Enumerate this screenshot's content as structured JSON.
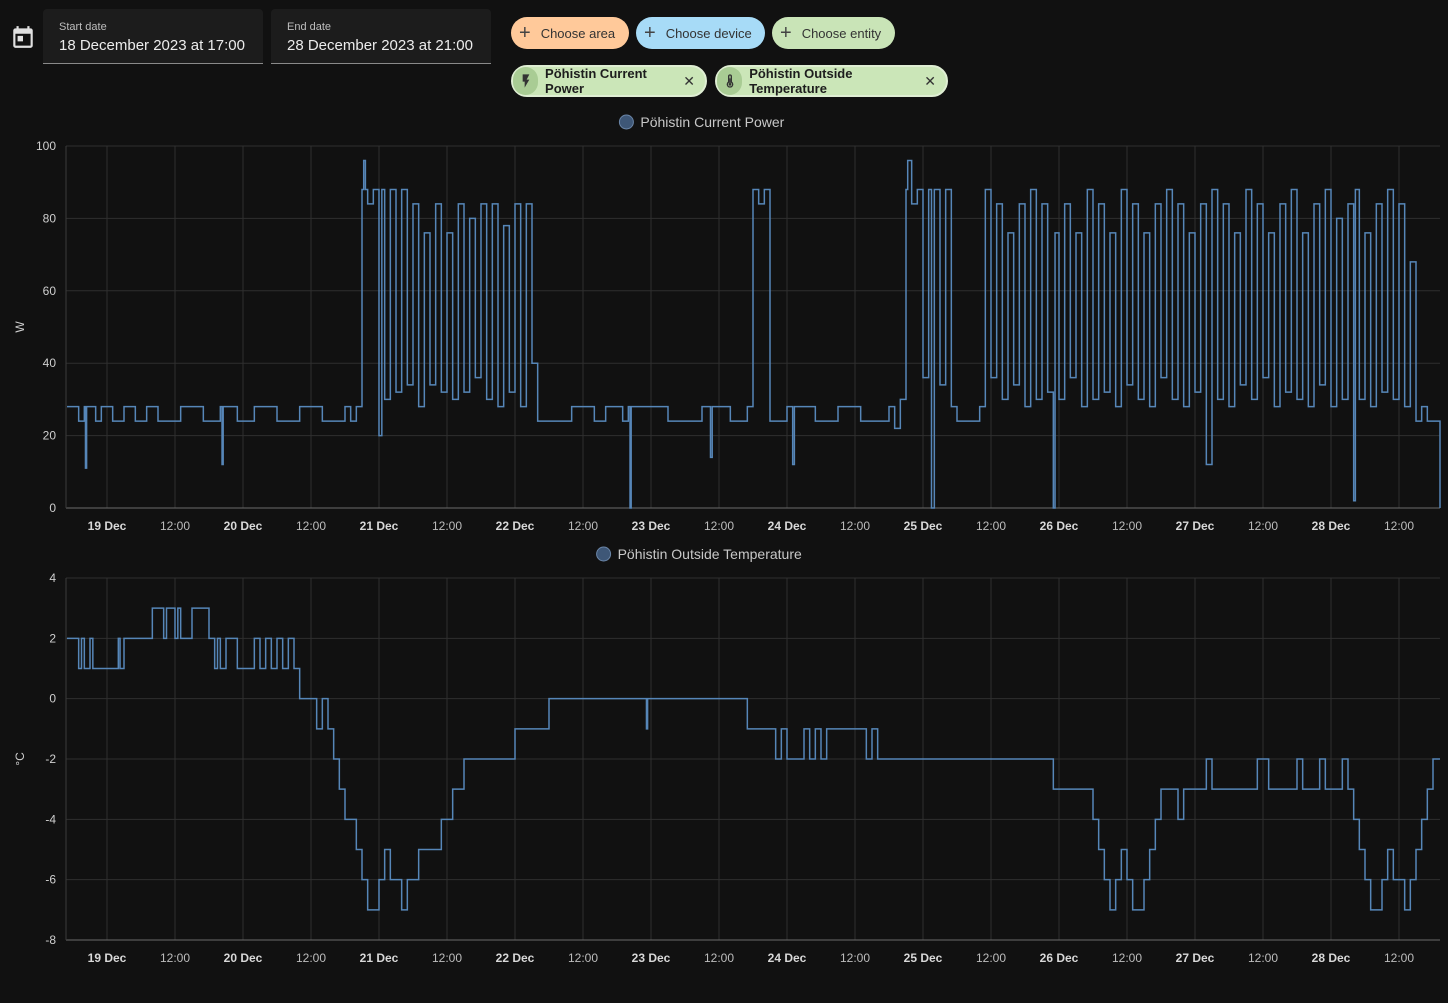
{
  "filters": {
    "start_label": "Start date",
    "start_value": "18 December 2023 at 17:00",
    "end_label": "End date",
    "end_value": "28 December 2023 at 21:00",
    "choose_area": "Choose area",
    "choose_device": "Choose device",
    "choose_entity": "Choose entity",
    "entities": [
      {
        "name": "Pöhistin Current Power",
        "icon": "flash-icon"
      },
      {
        "name": "Pöhistin Outside Temperature",
        "icon": "thermometer-icon"
      }
    ]
  },
  "colors": {
    "series": "#5686b8",
    "legend_dot": "#3e5777",
    "background": "#111111",
    "grid": "#2f2f2f"
  },
  "chart_data": [
    {
      "type": "line",
      "step": true,
      "series": [
        {
          "name": "Pöhistin Current Power"
        }
      ],
      "ylabel": "W",
      "ylim": [
        0,
        100
      ],
      "yticks": [
        "100",
        "80",
        "60",
        "40",
        "20",
        "0"
      ],
      "xticks": [
        "19 Dec",
        "12:00",
        "20 Dec",
        "12:00",
        "21 Dec",
        "12:00",
        "22 Dec",
        "12:00",
        "23 Dec",
        "12:00",
        "24 Dec",
        "12:00",
        "25 Dec",
        "12:00",
        "26 Dec",
        "12:00",
        "27 Dec",
        "12:00",
        "28 Dec",
        "12:00"
      ],
      "x_unit": "hours from 18 Dec 17:00",
      "points": [
        [
          0,
          28
        ],
        [
          2,
          24
        ],
        [
          3,
          28
        ],
        [
          3.2,
          11
        ],
        [
          3.4,
          28
        ],
        [
          5,
          24
        ],
        [
          6,
          28
        ],
        [
          8,
          24
        ],
        [
          10,
          28
        ],
        [
          12,
          24
        ],
        [
          14,
          28
        ],
        [
          16,
          24
        ],
        [
          20,
          28
        ],
        [
          24,
          24
        ],
        [
          27,
          28
        ],
        [
          27.3,
          12
        ],
        [
          27.5,
          28
        ],
        [
          30,
          24
        ],
        [
          33,
          28
        ],
        [
          37,
          24
        ],
        [
          41,
          28
        ],
        [
          45,
          24
        ],
        [
          49,
          28
        ],
        [
          50,
          24
        ],
        [
          51,
          28
        ],
        [
          52,
          88
        ],
        [
          52.3,
          96
        ],
        [
          52.6,
          88
        ],
        [
          53,
          84
        ],
        [
          54,
          88
        ],
        [
          55,
          20
        ],
        [
          55.5,
          88
        ],
        [
          56,
          30
        ],
        [
          57,
          88
        ],
        [
          58,
          32
        ],
        [
          59,
          88
        ],
        [
          60,
          34
        ],
        [
          61,
          84
        ],
        [
          62,
          28
        ],
        [
          63,
          76
        ],
        [
          64,
          34
        ],
        [
          65,
          84
        ],
        [
          66,
          32
        ],
        [
          67,
          76
        ],
        [
          68,
          30
        ],
        [
          69,
          84
        ],
        [
          70,
          32
        ],
        [
          71,
          80
        ],
        [
          72,
          36
        ],
        [
          73,
          84
        ],
        [
          74,
          30
        ],
        [
          75,
          84
        ],
        [
          76,
          28
        ],
        [
          77,
          78
        ],
        [
          78,
          32
        ],
        [
          79,
          84
        ],
        [
          80,
          28
        ],
        [
          81,
          84
        ],
        [
          82,
          40
        ],
        [
          83,
          24
        ],
        [
          89,
          28
        ],
        [
          93,
          24
        ],
        [
          95,
          28
        ],
        [
          98,
          24
        ],
        [
          99,
          28
        ],
        [
          99.3,
          0
        ],
        [
          99.5,
          28
        ],
        [
          106,
          24
        ],
        [
          112,
          28
        ],
        [
          113.5,
          14
        ],
        [
          113.8,
          28
        ],
        [
          117,
          24
        ],
        [
          120,
          28
        ],
        [
          121,
          88
        ],
        [
          122,
          84
        ],
        [
          123,
          88
        ],
        [
          124,
          24
        ],
        [
          127,
          28
        ],
        [
          128,
          12
        ],
        [
          128.3,
          28
        ],
        [
          132,
          24
        ],
        [
          136,
          28
        ],
        [
          140,
          24
        ],
        [
          145,
          28
        ],
        [
          146,
          22
        ],
        [
          147,
          30
        ],
        [
          148,
          88
        ],
        [
          148.3,
          96
        ],
        [
          149,
          84
        ],
        [
          150,
          88
        ],
        [
          151,
          36
        ],
        [
          152,
          88
        ],
        [
          152.5,
          0
        ],
        [
          153,
          88
        ],
        [
          154,
          34
        ],
        [
          155,
          88
        ],
        [
          156,
          28
        ],
        [
          157,
          24
        ],
        [
          161,
          28
        ],
        [
          162,
          88
        ],
        [
          163,
          36
        ],
        [
          164,
          84
        ],
        [
          165,
          30
        ],
        [
          166,
          76
        ],
        [
          167,
          34
        ],
        [
          168,
          84
        ],
        [
          169,
          28
        ],
        [
          170,
          88
        ],
        [
          171,
          30
        ],
        [
          172,
          84
        ],
        [
          173,
          32
        ],
        [
          174,
          0
        ],
        [
          174.3,
          76
        ],
        [
          175,
          30
        ],
        [
          176,
          84
        ],
        [
          177,
          36
        ],
        [
          178,
          76
        ],
        [
          179,
          28
        ],
        [
          180,
          88
        ],
        [
          181,
          30
        ],
        [
          182,
          84
        ],
        [
          183,
          32
        ],
        [
          184,
          76
        ],
        [
          185,
          28
        ],
        [
          186,
          88
        ],
        [
          187,
          34
        ],
        [
          188,
          84
        ],
        [
          189,
          30
        ],
        [
          190,
          76
        ],
        [
          191,
          28
        ],
        [
          192,
          84
        ],
        [
          193,
          36
        ],
        [
          194,
          88
        ],
        [
          195,
          30
        ],
        [
          196,
          84
        ],
        [
          197,
          28
        ],
        [
          198,
          76
        ],
        [
          199,
          32
        ],
        [
          200,
          84
        ],
        [
          201,
          12
        ],
        [
          202,
          88
        ],
        [
          203,
          30
        ],
        [
          204,
          84
        ],
        [
          205,
          28
        ],
        [
          206,
          76
        ],
        [
          207,
          34
        ],
        [
          208,
          88
        ],
        [
          209,
          30
        ],
        [
          210,
          84
        ],
        [
          211,
          36
        ],
        [
          212,
          76
        ],
        [
          213,
          28
        ],
        [
          214,
          84
        ],
        [
          215,
          32
        ],
        [
          216,
          88
        ],
        [
          217,
          30
        ],
        [
          218,
          76
        ],
        [
          219,
          28
        ],
        [
          220,
          84
        ],
        [
          221,
          34
        ],
        [
          222,
          88
        ],
        [
          223,
          28
        ],
        [
          224,
          80
        ],
        [
          225,
          30
        ],
        [
          226,
          84
        ],
        [
          227,
          2
        ],
        [
          227.3,
          88
        ],
        [
          228,
          30
        ],
        [
          229,
          76
        ],
        [
          230,
          28
        ],
        [
          231,
          84
        ],
        [
          232,
          32
        ],
        [
          233,
          88
        ],
        [
          234,
          30
        ],
        [
          235,
          84
        ],
        [
          236,
          28
        ],
        [
          237,
          68
        ],
        [
          238,
          24
        ],
        [
          239,
          28
        ],
        [
          240,
          24
        ],
        [
          243,
          0
        ],
        [
          244.5,
          0
        ]
      ]
    },
    {
      "type": "line",
      "step": true,
      "series": [
        {
          "name": "Pöhistin Outside Temperature"
        }
      ],
      "ylabel": "°C",
      "ylim": [
        -8,
        4
      ],
      "yticks": [
        "4",
        "2",
        "0",
        "-2",
        "-4",
        "-6",
        "-8"
      ],
      "xticks": [
        "19 Dec",
        "12:00",
        "20 Dec",
        "12:00",
        "21 Dec",
        "12:00",
        "22 Dec",
        "12:00",
        "23 Dec",
        "12:00",
        "24 Dec",
        "12:00",
        "25 Dec",
        "12:00",
        "26 Dec",
        "12:00",
        "27 Dec",
        "12:00",
        "28 Dec",
        "12:00"
      ],
      "x_unit": "hours from 18 Dec 17:00",
      "points": [
        [
          0,
          2
        ],
        [
          2,
          1
        ],
        [
          2.5,
          2
        ],
        [
          3,
          1
        ],
        [
          4,
          2
        ],
        [
          4.5,
          1
        ],
        [
          9,
          2
        ],
        [
          9.3,
          1
        ],
        [
          10,
          2
        ],
        [
          15,
          3
        ],
        [
          17,
          2
        ],
        [
          17.5,
          3
        ],
        [
          19,
          2
        ],
        [
          19.5,
          3
        ],
        [
          20,
          2
        ],
        [
          22,
          3
        ],
        [
          25,
          2
        ],
        [
          26,
          1
        ],
        [
          26.5,
          2
        ],
        [
          27,
          1
        ],
        [
          28,
          2
        ],
        [
          30,
          1
        ],
        [
          33,
          2
        ],
        [
          34,
          1
        ],
        [
          35,
          2
        ],
        [
          36,
          1
        ],
        [
          37,
          2
        ],
        [
          38,
          1
        ],
        [
          39,
          2
        ],
        [
          40,
          1
        ],
        [
          41,
          0
        ],
        [
          44,
          -1
        ],
        [
          45,
          0
        ],
        [
          46,
          -1
        ],
        [
          47,
          -2
        ],
        [
          48,
          -3
        ],
        [
          49,
          -4
        ],
        [
          50,
          -4
        ],
        [
          51,
          -5
        ],
        [
          52,
          -6
        ],
        [
          53,
          -7
        ],
        [
          55,
          -6
        ],
        [
          56,
          -5
        ],
        [
          57,
          -6
        ],
        [
          59,
          -7
        ],
        [
          60,
          -6
        ],
        [
          62,
          -5
        ],
        [
          66,
          -4
        ],
        [
          68,
          -3
        ],
        [
          70,
          -2
        ],
        [
          79,
          -1
        ],
        [
          85,
          0
        ],
        [
          90,
          0
        ],
        [
          102,
          0
        ],
        [
          102.2,
          -1
        ],
        [
          102.4,
          0
        ],
        [
          120,
          -1
        ],
        [
          122,
          -1
        ],
        [
          125,
          -2
        ],
        [
          126,
          -1
        ],
        [
          127,
          -2
        ],
        [
          130,
          -1
        ],
        [
          131,
          -2
        ],
        [
          132,
          -1
        ],
        [
          133,
          -2
        ],
        [
          134,
          -1
        ],
        [
          141,
          -2
        ],
        [
          142,
          -1
        ],
        [
          143,
          -2
        ],
        [
          174,
          -3
        ],
        [
          180,
          -3
        ],
        [
          181,
          -4
        ],
        [
          182,
          -5
        ],
        [
          183,
          -6
        ],
        [
          184,
          -7
        ],
        [
          185,
          -6
        ],
        [
          186,
          -5
        ],
        [
          187,
          -6
        ],
        [
          188,
          -7
        ],
        [
          190,
          -6
        ],
        [
          191,
          -5
        ],
        [
          192,
          -4
        ],
        [
          193,
          -3
        ],
        [
          196,
          -4
        ],
        [
          197,
          -3
        ],
        [
          201,
          -2
        ],
        [
          202,
          -3
        ],
        [
          210,
          -2
        ],
        [
          212,
          -3
        ],
        [
          217,
          -2
        ],
        [
          218,
          -3
        ],
        [
          221,
          -2
        ],
        [
          222,
          -3
        ],
        [
          225,
          -2
        ],
        [
          226,
          -3
        ],
        [
          227,
          -4
        ],
        [
          228,
          -5
        ],
        [
          229,
          -6
        ],
        [
          230,
          -7
        ],
        [
          232,
          -6
        ],
        [
          233,
          -5
        ],
        [
          234,
          -6
        ],
        [
          236,
          -7
        ],
        [
          237,
          -6
        ],
        [
          238,
          -5
        ],
        [
          239,
          -4
        ],
        [
          240,
          -3
        ],
        [
          241,
          -2
        ],
        [
          244.5,
          -2
        ]
      ]
    }
  ]
}
